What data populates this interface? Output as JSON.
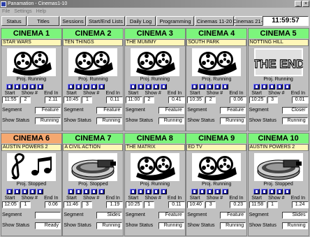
{
  "window": {
    "title": "Panamation - Cinemas1-10"
  },
  "menu": [
    "File",
    "Settings",
    "Help"
  ],
  "toolbar": [
    "Status",
    "Titles",
    "Sessions",
    "Start/End Lists",
    "Daily Log",
    "Programming",
    "Cinemas 11-20",
    "Cinemas 21-30"
  ],
  "clock": "11:59:57",
  "labels": {
    "start": "Start",
    "show": "Show #",
    "end_in": "End In",
    "segment": "Segment",
    "show_status": "Show Status"
  },
  "colors": {
    "running": "#7cf57c",
    "stopped": "#f5a870"
  },
  "cinemas": [
    {
      "name": "CINEMA 1",
      "film": "STAR WARS",
      "state": "running",
      "image": "film-reel",
      "status": "Proj. Running",
      "start": "11:55",
      "show": "2",
      "end_in": "2.11",
      "segment": "Feature",
      "show_status": "Running"
    },
    {
      "name": "CINEMA 2",
      "film": "TEN THINGS",
      "state": "running",
      "image": "film-reel",
      "status": "Proj. Running",
      "start": "10:45",
      "show": "1",
      "end_in": "0.11",
      "segment": "Feature",
      "show_status": "Running"
    },
    {
      "name": "CINEMA 3",
      "film": "THE MUMMY",
      "state": "running",
      "image": "film-reel",
      "status": "Proj. Running",
      "start": "11:00",
      "show": "2",
      "end_in": "0.41",
      "segment": "Feature",
      "show_status": "Running"
    },
    {
      "name": "CINEMA 4",
      "film": "SOUTH PARK",
      "state": "running",
      "image": "film-reel",
      "status": "Proj. Running",
      "start": "10:35",
      "show": "2",
      "end_in": "0.06",
      "segment": "Feature",
      "show_status": "Running"
    },
    {
      "name": "CINEMA 5",
      "film": "NOTTING HILL",
      "state": "running",
      "image": "the-end",
      "image_text": "THE END",
      "status": "Proj. Running",
      "start": "10:25",
      "show": "3",
      "end_in": "0.01",
      "segment": "Closer",
      "show_status": "Running"
    },
    {
      "name": "CINEMA 6",
      "film": "AUSTIN POWERS 2",
      "state": "stopped",
      "image": "music-notes",
      "status": "Proj. Stopped",
      "start": "12:05",
      "show": "1",
      "end_in": "0.06",
      "segment": "",
      "show_status": "Ready"
    },
    {
      "name": "CINEMA 7",
      "film": "A CIVIL ACTION",
      "state": "running",
      "image": "projector",
      "status": "Proj. Stopped",
      "start": "11:46",
      "show": "3",
      "end_in": "1.19",
      "segment": "Slides",
      "show_status": "Running"
    },
    {
      "name": "CINEMA 8",
      "film": "THE MATRIX",
      "state": "running",
      "image": "film-reel",
      "status": "Proj. Running",
      "start": "10:25",
      "show": "1",
      "end_in": "0.11",
      "segment": "Feature",
      "show_status": "Running"
    },
    {
      "name": "CINEMA 9",
      "film": "ED TV",
      "state": "running",
      "image": "film-reel",
      "status": "Proj. Running",
      "start": "10:40",
      "show": "3",
      "end_in": "0.23",
      "segment": "Feature",
      "show_status": "Running"
    },
    {
      "name": "CINEMA 10",
      "film": "AUSTIN POWERS 2",
      "state": "running",
      "image": "projector",
      "status": "Proj. Stopped",
      "start": "11:58",
      "show": "1",
      "end_in": "1.24",
      "segment": "Slides",
      "show_status": "Running"
    }
  ]
}
